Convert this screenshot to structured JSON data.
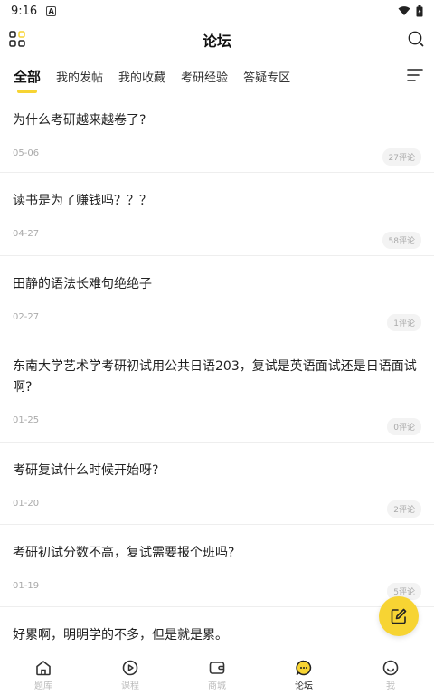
{
  "status_bar": {
    "time": "9:16",
    "notification_letter": "A"
  },
  "header": {
    "title": "论坛"
  },
  "tabs": [
    {
      "label": "全部",
      "active": true
    },
    {
      "label": "我的发帖",
      "active": false
    },
    {
      "label": "我的收藏",
      "active": false
    },
    {
      "label": "考研经验",
      "active": false
    },
    {
      "label": "答疑专区",
      "active": false
    }
  ],
  "posts": [
    {
      "title": "为什么考研越来越卷了?",
      "date": "05-06",
      "comments": "27评论"
    },
    {
      "title": "读书是为了赚钱吗？？？",
      "date": "04-27",
      "comments": "58评论"
    },
    {
      "title": "田静的语法长难句绝绝子",
      "date": "02-27",
      "comments": "1评论"
    },
    {
      "title": "东南大学艺术学考研初试用公共日语203，复试是英语面试还是日语面试啊?",
      "date": "01-25",
      "comments": "0评论"
    },
    {
      "title": "考研复试什么时候开始呀?",
      "date": "01-20",
      "comments": "2评论"
    },
    {
      "title": "考研初试分数不高，复试需要报个班吗?",
      "date": "01-19",
      "comments": "5评论"
    },
    {
      "title": "好累啊，明明学的不多，但是就是累。",
      "date": "",
      "comments": ""
    }
  ],
  "bottom_nav": [
    {
      "label": "题库",
      "icon": "home-icon",
      "active": false
    },
    {
      "label": "课程",
      "icon": "play-circle-icon",
      "active": false
    },
    {
      "label": "商城",
      "icon": "wallet-icon",
      "active": false
    },
    {
      "label": "论坛",
      "icon": "chat-bubble-icon",
      "active": true
    },
    {
      "label": "我",
      "icon": "smile-icon",
      "active": false
    }
  ],
  "colors": {
    "accent": "#f7d433",
    "text": "#222222",
    "muted": "#aaaaaa"
  }
}
